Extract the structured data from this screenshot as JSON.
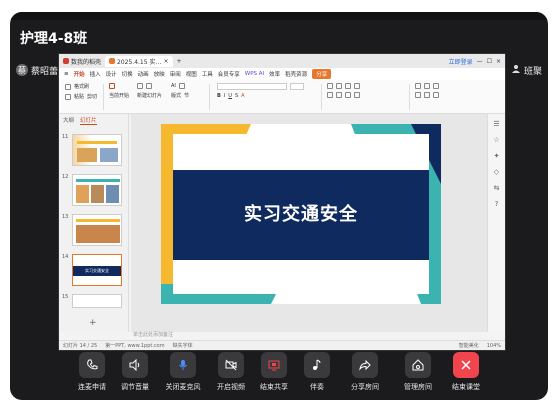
{
  "room": {
    "title": "护理4-8班"
  },
  "presenter": {
    "avatar_initial": "蔡",
    "name": "蔡昭蕾"
  },
  "attendees": {
    "label": "班聚"
  },
  "screen": {
    "tabs": [
      {
        "label": "数我的稻壳",
        "color": "#d33c31"
      },
      {
        "label": "2025.4.15 实…",
        "color": "#e8772e"
      }
    ],
    "tab_right": {
      "login": "立即登录",
      "share": "分享"
    },
    "menu": [
      "开始",
      "插入",
      "设计",
      "切换",
      "动画",
      "放映",
      "审阅",
      "视图",
      "工具",
      "会员专享",
      "WPS AI",
      "效率",
      "稻壳资源"
    ],
    "menu_active": "开始",
    "wps_ai": "WPS AI",
    "ribbon": {
      "format_painter": "格式刷",
      "paste": "粘贴",
      "cut": "剪切",
      "current_start": "当前开始",
      "new_slide": "新建幻灯片",
      "layout": "版式",
      "section": "节",
      "ai_label": "AI"
    },
    "thumbs_tabs": [
      "大纲",
      "幻灯片"
    ],
    "thumb_numbers": [
      "11",
      "12",
      "13",
      "14",
      "15"
    ],
    "selected_thumb_text": "实习交通安全",
    "slide": {
      "title": "实习交通安全"
    },
    "notes_hint": "单击此处添加备注",
    "status": {
      "slide_pos": "幻灯片 14 / 25",
      "theme": "第一PPT, www.1ppt.com",
      "font_hint": "缺失字体",
      "smart_beauty": "智能美化",
      "zoom": "104%"
    },
    "right_rail_icons": [
      "properties-icon",
      "star-icon",
      "magic-icon",
      "shapes-icon",
      "translate-icon",
      "help-icon"
    ]
  },
  "controls": [
    {
      "label": "连麦申请",
      "icon": "phone-icon"
    },
    {
      "label": "调节音量",
      "icon": "speaker-icon"
    },
    {
      "label": "关闭麦克风",
      "icon": "mic-icon"
    },
    {
      "label": "开启视频",
      "icon": "video-off-icon"
    },
    {
      "label": "结束共享",
      "icon": "stop-share-icon"
    },
    {
      "label": "伴奏",
      "icon": "music-icon"
    },
    {
      "label": "分享房间",
      "icon": "share-icon"
    },
    {
      "label": "管理房间",
      "icon": "home-gear-icon"
    },
    {
      "label": "结束课堂",
      "icon": "close-icon"
    }
  ],
  "colors": {
    "accent_red": "#f0454f",
    "slide_navy": "#0f2a5e",
    "slide_teal": "#3bb3b0",
    "slide_yellow": "#f5b82e"
  }
}
